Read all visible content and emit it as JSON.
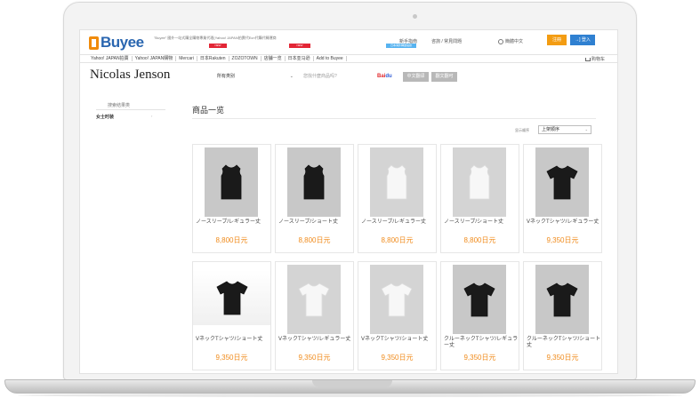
{
  "header": {
    "logo_text": "Buyee",
    "tagline": "\"Buyee\" 國外一站式購全購物專業代理(Yahoo! JAPAN拍賣代Ecn代購代轉運商",
    "new_tag_1": "NEW",
    "new_tag_2": "NEW",
    "blue_tag": "日本海外轉運站熱",
    "beginner": "新手指南",
    "help": "咨詢 / 常見問題",
    "language": "簡體中文",
    "register": "注冊",
    "login": "登入"
  },
  "nav": {
    "items": [
      "Yahoo! JAPAN拍賣",
      "Yahoo! JAPAN購物",
      "Mercari",
      "日本Rakuten",
      "ZOZOTOWN",
      "店舗一览",
      "日本亚马逊",
      "Add to Buyee"
    ],
    "cart": "购物车"
  },
  "search": {
    "store_name": "Nicolas Jenson",
    "category": "所有类别",
    "placeholder": "您找什麼商品吗?",
    "baidu_red": "Bai",
    "baidu_blue": "du",
    "btn_cn_translate": "中文翻译",
    "btn_jp_translate": "翻文翻可"
  },
  "sidebar": {
    "title": "搜索结果类",
    "category": "女士时装"
  },
  "main": {
    "title": "商品一览",
    "sort_label": "显示顺序",
    "sort_value": "上架顺序"
  },
  "products": [
    {
      "name": "ノースリーブ/レギュラー丈",
      "price": "8,800日元",
      "color": "black",
      "shape": "tank"
    },
    {
      "name": "ノースリーブ/ショート丈",
      "price": "8,800日元",
      "color": "black",
      "shape": "tank"
    },
    {
      "name": "ノースリーブ/レギュラー丈",
      "price": "8,800日元",
      "color": "white",
      "shape": "tank"
    },
    {
      "name": "ノースリーブ/ショート丈",
      "price": "8,800日元",
      "color": "white",
      "shape": "tank"
    },
    {
      "name": "VネックTシャツ/レギュラー丈",
      "price": "9,350日元",
      "color": "black",
      "shape": "tee"
    },
    {
      "name": "VネックTシャツ/ショート丈",
      "price": "9,350日元",
      "color": "black",
      "shape": "photo"
    },
    {
      "name": "VネックTシャツ/レギュラー丈",
      "price": "9,350日元",
      "color": "white",
      "shape": "tee"
    },
    {
      "name": "VネックTシャツ/ショート丈",
      "price": "9,350日元",
      "color": "white",
      "shape": "tee"
    },
    {
      "name": "クルーネックTシャツ/レギュラー丈",
      "price": "9,350日元",
      "color": "black",
      "shape": "tee"
    },
    {
      "name": "クルーネックTシャツ/ショート丈",
      "price": "9,350日元",
      "color": "black",
      "shape": "tee"
    }
  ],
  "colors": {
    "accent_orange": "#f08b1c",
    "brand_blue": "#2a66b0",
    "new_red": "#e32636"
  }
}
